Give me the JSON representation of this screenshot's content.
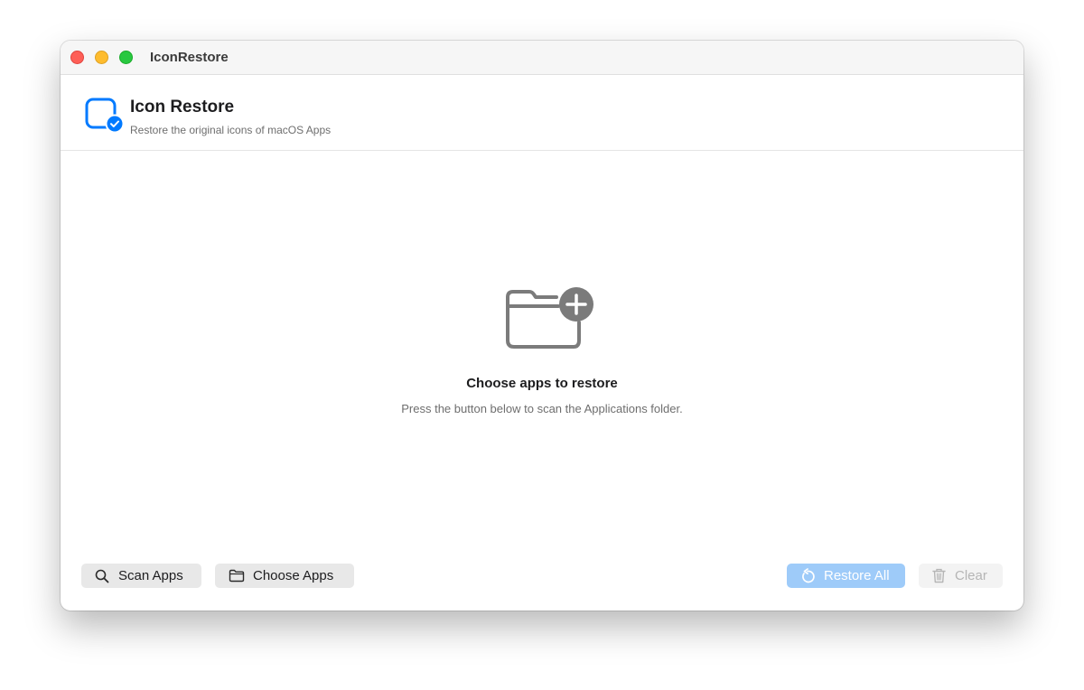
{
  "window": {
    "title": "IconRestore"
  },
  "header": {
    "app_name": "Icon Restore",
    "subtitle": "Restore the original icons of macOS Apps",
    "icon": "app-square-checkmark-icon"
  },
  "empty_state": {
    "icon": "folder-plus-icon",
    "title": "Choose apps to restore",
    "subtitle": "Press the button below to scan the Applications folder."
  },
  "toolbar": {
    "scan_label": "Scan Apps",
    "scan_icon": "search-icon",
    "choose_label": "Choose Apps",
    "choose_icon": "folder-icon",
    "restore_label": "Restore All",
    "restore_icon": "restore-arrow-icon",
    "clear_label": "Clear",
    "clear_icon": "trash-icon"
  },
  "colors": {
    "accent": "#007aff",
    "restore_button_disabled": "#9ecbf9",
    "traffic_close": "#fe5f57",
    "traffic_minimize": "#febc2e",
    "traffic_maximize": "#28c840"
  }
}
